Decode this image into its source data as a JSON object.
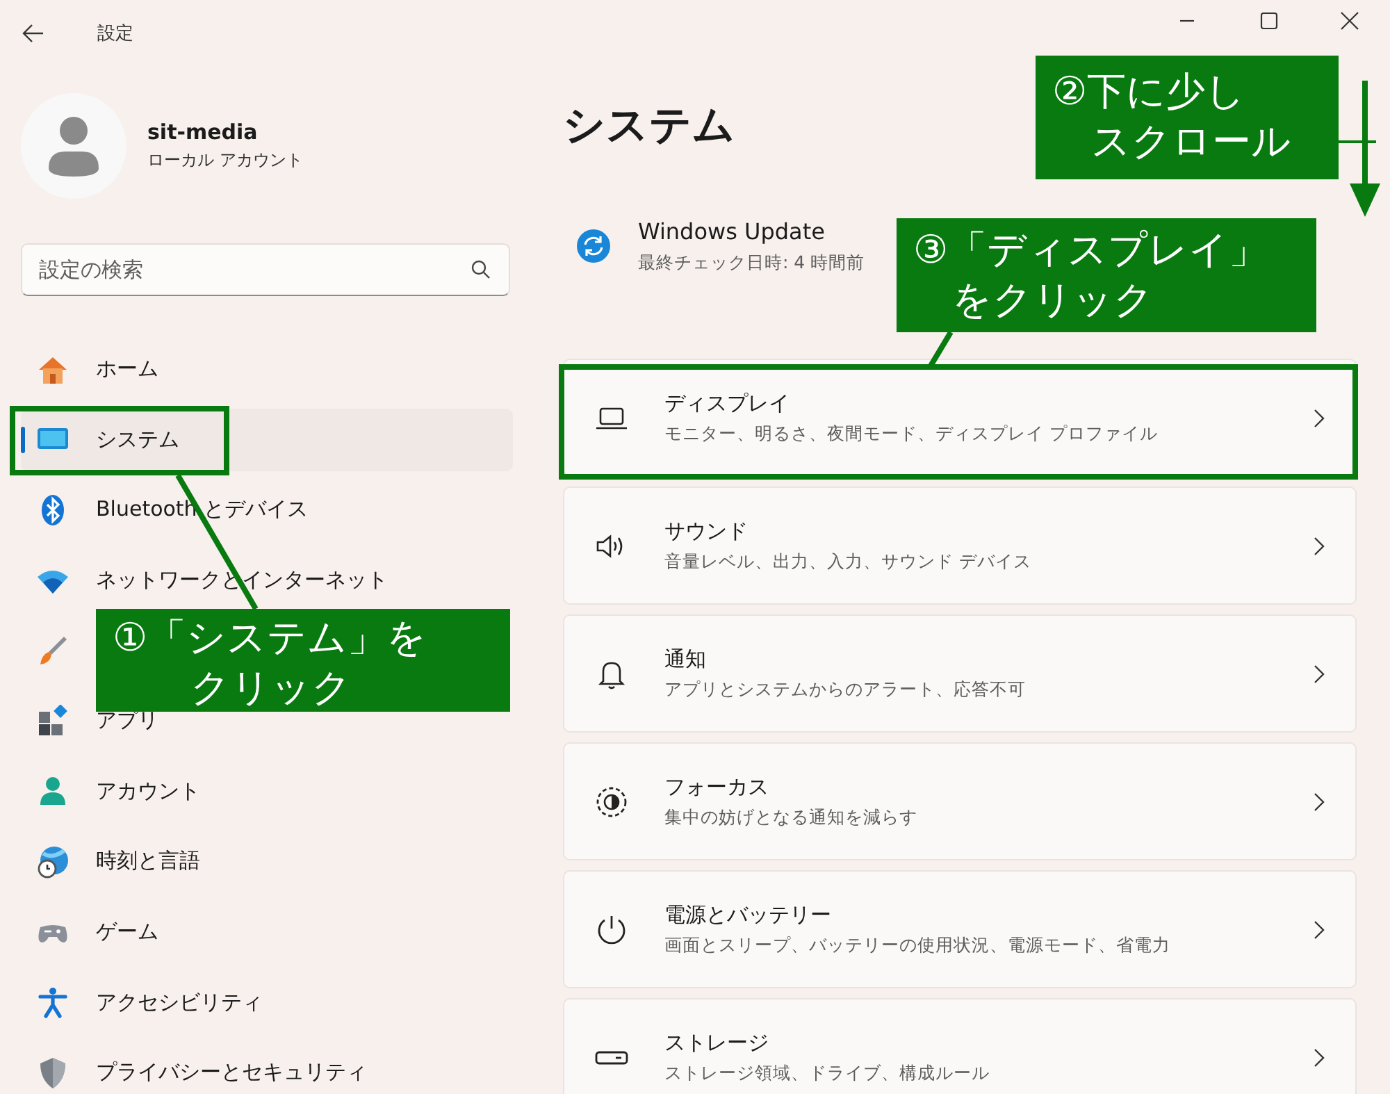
{
  "window": {
    "title": "設定"
  },
  "profile": {
    "name": "sit-media",
    "account_type": "ローカル アカウント"
  },
  "search": {
    "placeholder": "設定の検索"
  },
  "sidebar": {
    "items": [
      {
        "kind": "home",
        "label": "ホーム",
        "selected": false
      },
      {
        "kind": "system",
        "label": "システム",
        "selected": true
      },
      {
        "kind": "bluetooth",
        "label": "Bluetooth とデバイス",
        "selected": false
      },
      {
        "kind": "network",
        "label": "ネットワークとインターネット",
        "selected": false
      },
      {
        "kind": "brush",
        "selected": false
      },
      {
        "kind": "apps",
        "label": "アプリ",
        "selected": false
      },
      {
        "kind": "account",
        "label": "アカウント",
        "selected": false
      },
      {
        "kind": "time",
        "label": "時刻と言語",
        "selected": false
      },
      {
        "kind": "gaming",
        "label": "ゲーム",
        "selected": false
      },
      {
        "kind": "accessibility",
        "label": "アクセシビリティ",
        "selected": false
      },
      {
        "kind": "privacy",
        "label": "プライバシーとセキュリティ",
        "selected": false
      }
    ]
  },
  "page": {
    "title": "システム",
    "update": {
      "title": "Windows Update",
      "subtitle": "最終チェック日時: 4 時間前"
    },
    "cards": [
      {
        "kind": "display",
        "title": "ディスプレイ",
        "subtitle": "モニター、明るさ、夜間モード、ディスプレイ プロファイル"
      },
      {
        "kind": "sound",
        "title": "サウンド",
        "subtitle": "音量レベル、出力、入力、サウンド デバイス"
      },
      {
        "kind": "notifications",
        "title": "通知",
        "subtitle": "アプリとシステムからのアラート、応答不可"
      },
      {
        "kind": "focus",
        "title": "フォーカス",
        "subtitle": "集中の妨げとなる通知を減らす"
      },
      {
        "kind": "power",
        "title": "電源とバッテリー",
        "subtitle": "画面とスリープ、バッテリーの使用状況、電源モード、省電力"
      },
      {
        "kind": "storage",
        "title": "ストレージ",
        "subtitle": "ストレージ領域、ドライブ、構成ルール"
      }
    ]
  },
  "annotations": [
    {
      "lines": [
        "①「システム」を",
        "クリック"
      ]
    },
    {
      "lines": [
        "②下に少し",
        "スクロール"
      ]
    },
    {
      "lines": [
        "③「ディスプレイ」",
        "をクリック"
      ]
    }
  ]
}
